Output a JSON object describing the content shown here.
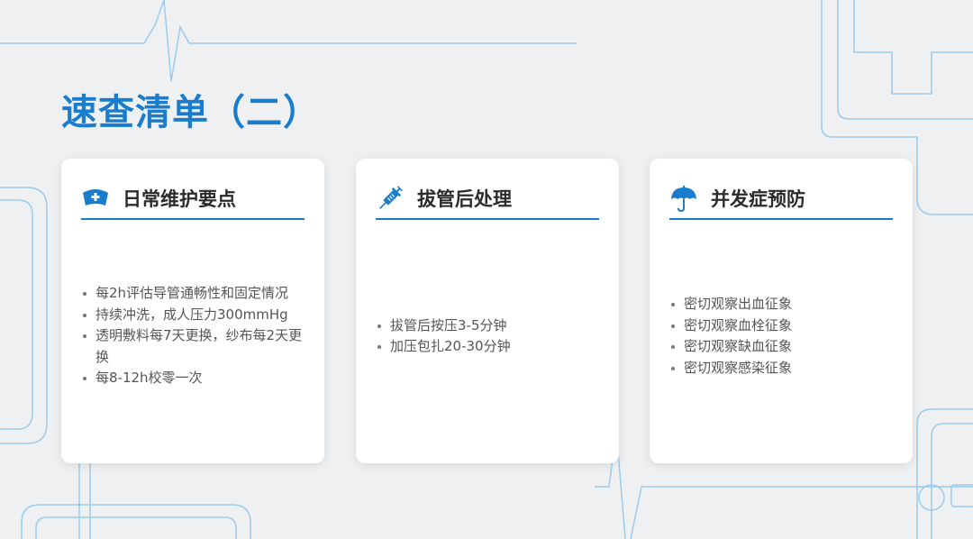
{
  "page": {
    "title": "速查清单（二）"
  },
  "colors": {
    "accent": "#1a7ccd",
    "card_bg": "#ffffff",
    "text": "#555555",
    "heading": "#2b2b2b"
  },
  "cards": [
    {
      "icon": "nurse-cap-icon",
      "title": "日常维护要点",
      "items": [
        "每2h评估导管通畅性和固定情况",
        "持续冲洗，成人压力300mmHg",
        "透明敷料每7天更换，纱布每2天更换",
        "每8-12h校零一次"
      ]
    },
    {
      "icon": "syringe-icon",
      "title": "拔管后处理",
      "items": [
        "拔管后按压3-5分钟",
        "加压包扎20-30分钟"
      ]
    },
    {
      "icon": "umbrella-icon",
      "title": "并发症预防",
      "items": [
        "密切观察出血征象",
        "密切观察血栓征象",
        "密切观察缺血征象",
        "密切观察感染征象"
      ]
    }
  ]
}
